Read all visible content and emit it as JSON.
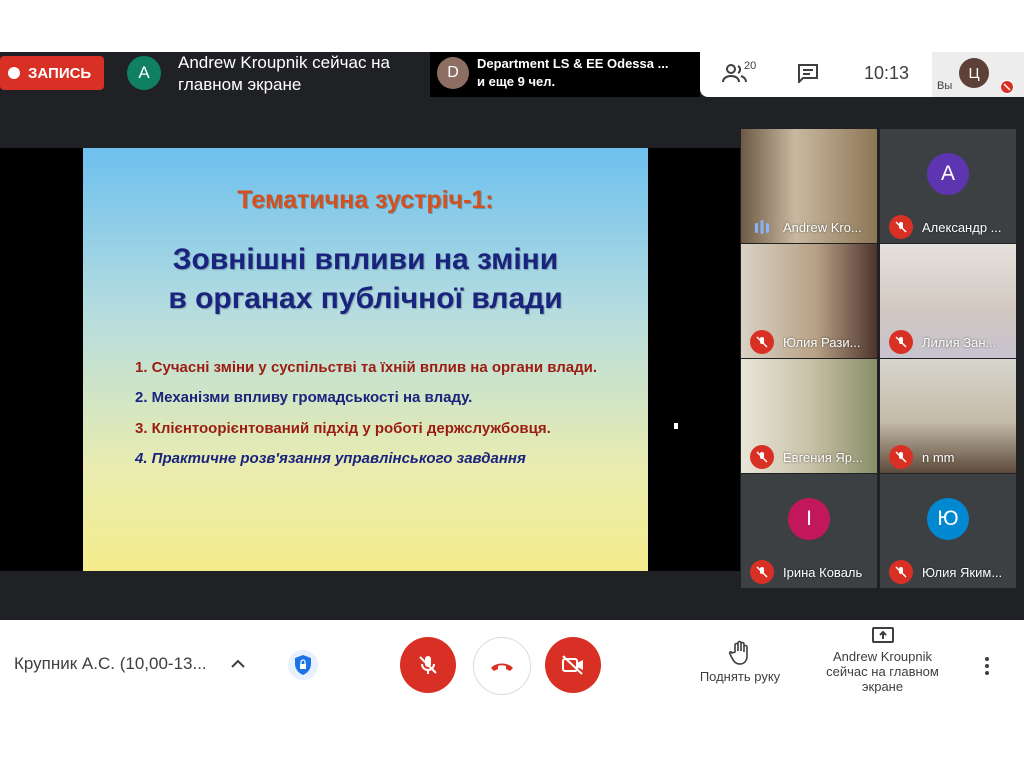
{
  "topbar": {
    "record_label": "ЗАПИСЬ",
    "presenter_initial": "A",
    "presenter_note": "Andrew Kroupnik сейчас на главном экране",
    "dept_initial": "D",
    "dept_name": "Department LS & EE Odessa ...",
    "dept_more": "и еще 9 чел.",
    "people_count": "20",
    "clock": "10:13",
    "you_initial": "Ц",
    "you_label": "Вы"
  },
  "slide": {
    "kicker": "Тематична зустріч-1:",
    "title_line1": "Зовнішні впливи на зміни",
    "title_line2": "в органах публічної влади",
    "items": [
      {
        "text": "1. Сучасні зміни у суспільстві та їхній вплив на органи влади.",
        "color": "#9c1c12"
      },
      {
        "text": "2. Механізми впливу громадськості на владу.",
        "color": "#1a237e"
      },
      {
        "text": "3. Клієнтоорієнтований підхід у роботі держслужбовця.",
        "color": "#9c1c12"
      },
      {
        "text": "4. Практичне розв'язання управлінського завдання",
        "color": "#1a237e"
      }
    ]
  },
  "participants": [
    {
      "name": "Andrew Kro...",
      "initial": "",
      "speaking": true,
      "avatar_color": ""
    },
    {
      "name": "Александр ...",
      "initial": "A",
      "speaking": false,
      "avatar_color": "#5e35b1"
    },
    {
      "name": "Юлия Рази...",
      "initial": "",
      "speaking": false,
      "avatar_color": ""
    },
    {
      "name": "Лилия Зан...",
      "initial": "",
      "speaking": false,
      "avatar_color": ""
    },
    {
      "name": "Евгения Яр...",
      "initial": "",
      "speaking": false,
      "avatar_color": ""
    },
    {
      "name": "n mm",
      "initial": "",
      "speaking": false,
      "avatar_color": ""
    },
    {
      "name": "Ірина Коваль",
      "initial": "І",
      "speaking": false,
      "avatar_color": "#c2185b"
    },
    {
      "name": "Юлия Яким...",
      "initial": "Ю",
      "speaking": false,
      "avatar_color": "#0288d1"
    }
  ],
  "bottombar": {
    "meeting_title": "Крупник А.С. (10,00-13...",
    "raise_hand_label": "Поднять руку",
    "present_label": "Andrew Kroupnik сейчас на главном экране"
  },
  "colors": {
    "accent_red": "#d93025",
    "dark_bg": "#202124"
  }
}
